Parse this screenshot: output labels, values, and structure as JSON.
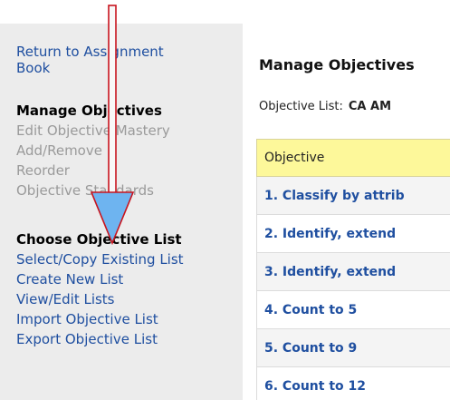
{
  "sidebar": {
    "return_link": [
      "Return to Assignment",
      "Book"
    ],
    "manage_heading": "Manage Objectives",
    "manage_items": [
      "Edit Objective Mastery",
      "Add/Remove",
      "Reorder",
      "Objective Standards"
    ],
    "choose_heading": "Choose Objective List",
    "choose_items": [
      "Select/Copy Existing List",
      "Create New List",
      "View/Edit Lists",
      "Import Objective List",
      "Export Objective List"
    ]
  },
  "main": {
    "title": "Manage Objectives",
    "list_label": "Objective List:",
    "list_value": "CA AM",
    "table": {
      "header": "Objective",
      "rows": [
        "1. Classify by attrib",
        "2. Identify, extend",
        "3. Identify, extend",
        "4. Count to 5",
        "5. Count to 9",
        "6. Count to 12"
      ]
    }
  },
  "colors": {
    "link": "#1f4fa0",
    "arrow": "#6eb4f0",
    "header_bg": "#fdf89a",
    "sidebar_bg": "#ececec"
  }
}
